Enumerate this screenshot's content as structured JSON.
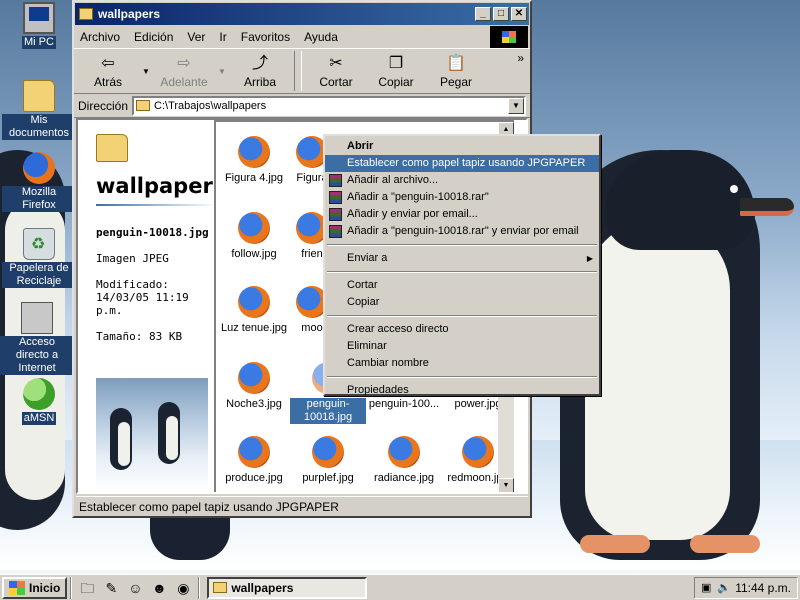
{
  "desktop": {
    "icons": [
      {
        "label": "Mi PC",
        "icon": "computer-icon"
      },
      {
        "label": "Mis documentos",
        "icon": "folder-icon"
      },
      {
        "label": "Mozilla Firefox",
        "icon": "firefox-icon"
      },
      {
        "label": "Papelera de Reciclaje",
        "icon": "recycle-bin-icon"
      },
      {
        "label": "Acceso directo a Internet",
        "icon": "network-icon"
      },
      {
        "label": "aMSN",
        "icon": "msn-icon"
      }
    ]
  },
  "window": {
    "title": "wallpapers",
    "menu": [
      "Archivo",
      "Edición",
      "Ver",
      "Ir",
      "Favoritos",
      "Ayuda"
    ],
    "toolbar": {
      "back": "Atrás",
      "forward": "Adelante",
      "up": "Arriba",
      "cut": "Cortar",
      "copy": "Copiar",
      "paste": "Pegar",
      "more": "»"
    },
    "address": {
      "label": "Dirección",
      "value": "C:\\Trabajos\\wallpapers"
    },
    "left_pane": {
      "title": "wallpaper",
      "file_name": "penguin-10018.jpg",
      "file_type": "Imagen JPEG",
      "modified": "Modificado: 14/03/05 11:19 p.m.",
      "size": "Tamaño: 83 KB"
    },
    "files": [
      {
        "name": "Figura 4.jpg"
      },
      {
        "name": "Figura"
      },
      {
        "name": "follow.jpg"
      },
      {
        "name": "frien"
      },
      {
        "name": "Luz tenue.jpg"
      },
      {
        "name": "moo"
      },
      {
        "name": "Noche3.jpg"
      },
      {
        "name": "penguin-10018.jpg",
        "selected": true
      },
      {
        "name": "penguin-100..."
      },
      {
        "name": "power.jpg"
      },
      {
        "name": "produce.jpg"
      },
      {
        "name": "purplef.jpg"
      },
      {
        "name": "radiance.jpg"
      },
      {
        "name": "redmoon.jpg"
      }
    ],
    "status": "Establecer como papel tapiz usando JPGPAPER"
  },
  "context_menu": {
    "items": [
      {
        "label": "Abrir",
        "bold": true
      },
      {
        "label": "Establecer como papel tapiz usando JPGPAPER",
        "highlighted": true
      },
      {
        "label": "Añadir al archivo...",
        "rar": true
      },
      {
        "label": "Añadir a \"penguin-10018.rar\"",
        "rar": true
      },
      {
        "label": "Añadir y enviar por email...",
        "rar": true
      },
      {
        "label": "Añadir a \"penguin-10018.rar\" y enviar por email",
        "rar": true
      },
      {
        "separator": true
      },
      {
        "label": "Enviar a",
        "submenu": true
      },
      {
        "separator": true
      },
      {
        "label": "Cortar"
      },
      {
        "label": "Copiar"
      },
      {
        "separator": true
      },
      {
        "label": "Crear acceso directo"
      },
      {
        "label": "Eliminar"
      },
      {
        "label": "Cambiar nombre"
      },
      {
        "separator": true
      },
      {
        "label": "Propiedades"
      }
    ]
  },
  "taskbar": {
    "start": "Inicio",
    "task": "wallpapers",
    "clock": "11:44 p.m."
  },
  "colors": {
    "titlebar": "#0a246a",
    "selection": "#3a6ea5",
    "face": "#d4d0c8"
  }
}
